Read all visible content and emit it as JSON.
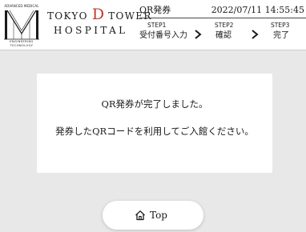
{
  "logo": {
    "top_text": "ADVANCED MEDICAL",
    "bottom_text_1": "ENGINEERING",
    "bottom_text_2": "TECHNOLOGY"
  },
  "hospital": {
    "name_pre": "TOKYO ",
    "name_d": "D",
    "name_post": " TOWER",
    "name_line2": "HOSPITAL"
  },
  "header": {
    "title": "QR発券",
    "datetime": "2022/07/11 14:55:45"
  },
  "steps": [
    {
      "num": "STEP1",
      "name": "受付番号入力"
    },
    {
      "num": "STEP2",
      "name": "確認"
    },
    {
      "num": "STEP3",
      "name": "完了"
    }
  ],
  "message": {
    "line1": "QR発券が完了しました。",
    "line2": "発券したQRコードを利用してご入館ください。"
  },
  "top_button": {
    "label": "Top",
    "icon": "home-icon"
  },
  "colors": {
    "accent_d": "#c0392b",
    "background": "#e8e8e8"
  }
}
